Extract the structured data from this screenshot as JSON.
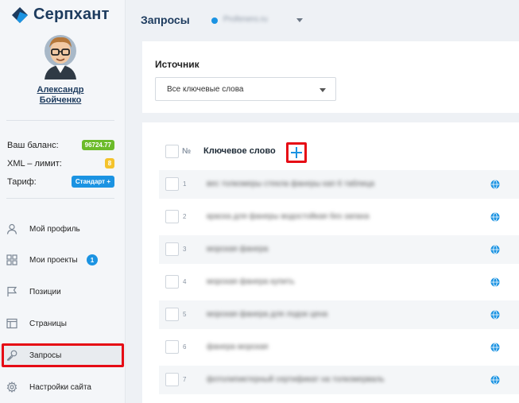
{
  "app": {
    "logo_text": "Серпхант"
  },
  "user": {
    "first_name": "Александр",
    "last_name": "Бойченко"
  },
  "account": {
    "balance_label": "Ваш баланс:",
    "balance_value": "96724.77",
    "xml_label": "XML – лимит:",
    "xml_value": "8",
    "tariff_label": "Тариф:",
    "tariff_value": "Стандарт +"
  },
  "nav": {
    "items": [
      {
        "label": "Мой профиль",
        "icon": "user-icon"
      },
      {
        "label": "Мои проекты",
        "icon": "grid-icon",
        "count": "1"
      },
      {
        "label": "Позиции",
        "icon": "flag-icon"
      },
      {
        "label": "Страницы",
        "icon": "pages-icon"
      },
      {
        "label": "Запросы",
        "icon": "key-icon",
        "active": true
      },
      {
        "label": "Настройки сайта",
        "icon": "gear-icon"
      }
    ]
  },
  "header": {
    "title": "Запросы",
    "project_name": "Profenero.ru"
  },
  "source": {
    "label": "Источник",
    "selected": "Все ключевые слова"
  },
  "keywords": {
    "col_number": "№",
    "col_keyword": "Ключевое слово",
    "rows": [
      {
        "n": "1",
        "text": "вес толкомеры стекла фанеры кап 6 таблица"
      },
      {
        "n": "2",
        "text": "краска для фанеры водостойкая без запаха"
      },
      {
        "n": "3",
        "text": "морская фанера"
      },
      {
        "n": "4",
        "text": "морская фанера купить"
      },
      {
        "n": "5",
        "text": "морская фанера для лодок цена"
      },
      {
        "n": "6",
        "text": "фанера морская"
      },
      {
        "n": "7",
        "text": "фотолипиктерный сертификат на толкомерваль"
      }
    ]
  },
  "colors": {
    "accent": "#1b93e2",
    "brand": "#1d3b5e",
    "highlight": "#e60b15",
    "balance_badge": "#6cbb2a",
    "xml_badge": "#f4c32c"
  }
}
